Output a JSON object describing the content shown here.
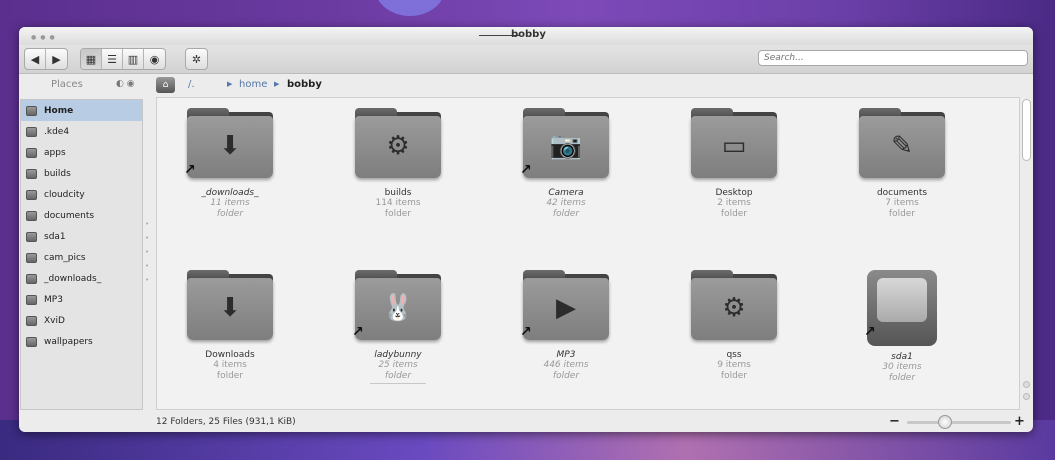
{
  "window": {
    "title": "bobby"
  },
  "toolbar": {
    "back_icon": "◀",
    "forward_icon": "▶",
    "icons_view_icon": "▦",
    "details_view_icon": "☰",
    "columns_view_icon": "▥",
    "preview_icon": "◉",
    "settings_icon": "✲",
    "search_placeholder": "Search..."
  },
  "places": {
    "title": "Places",
    "items": [
      {
        "label": "Home",
        "active": true
      },
      {
        "label": ".kde4"
      },
      {
        "label": "apps"
      },
      {
        "label": "builds"
      },
      {
        "label": "cloudcity"
      },
      {
        "label": "documents"
      },
      {
        "label": "sda1"
      },
      {
        "label": "cam_pics"
      },
      {
        "label": "_downloads_"
      },
      {
        "label": "MP3"
      },
      {
        "label": "XviD"
      },
      {
        "label": "wallpapers"
      }
    ]
  },
  "breadcrumb": {
    "root": "/.",
    "home": "home",
    "current": "bobby"
  },
  "files": [
    {
      "name": "_downloads_",
      "count": "11 items",
      "type": "folder",
      "glyph": "⬇",
      "link": true
    },
    {
      "name": "builds",
      "count": "114 items",
      "type": "folder",
      "glyph": "⚙",
      "link": false
    },
    {
      "name": "Camera",
      "count": "42 items",
      "type": "folder",
      "glyph": "📷",
      "link": true
    },
    {
      "name": "Desktop",
      "count": "2 items",
      "type": "folder",
      "glyph": "▭",
      "link": false
    },
    {
      "name": "documents",
      "count": "7 items",
      "type": "folder",
      "glyph": "✎",
      "link": false
    },
    {
      "name": "Downloads",
      "count": "4 items",
      "type": "folder",
      "glyph": "⬇",
      "link": false
    },
    {
      "name": "ladybunny",
      "count": "25 items",
      "type": "folder",
      "glyph": "🐰",
      "link": true
    },
    {
      "name": "MP3",
      "count": "446 items",
      "type": "folder",
      "glyph": "▶",
      "link": true
    },
    {
      "name": "qss",
      "count": "9 items",
      "type": "folder",
      "glyph": "⚙",
      "link": false
    },
    {
      "name": "sda1",
      "count": "30 items",
      "type": "folder",
      "glyph": "",
      "link": true
    }
  ],
  "status": {
    "summary": "12 Folders, 25 Files (931,1 KiB)",
    "zoom_minus": "−",
    "zoom_plus": "+"
  }
}
